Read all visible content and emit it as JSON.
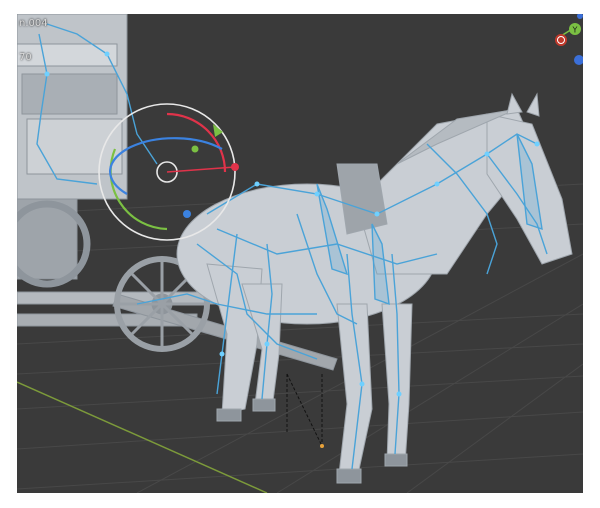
{
  "viewport": {
    "object_name": "n.004",
    "overlay_value": "70"
  },
  "axis_gizmo": {
    "y_axis_label": "Y"
  },
  "colors": {
    "background": "#3a3a3a",
    "grid": "#484848",
    "floor_x_axis": "#7c9a3a",
    "model": "#c9ced4",
    "armature": "#4aa3d8",
    "gizmo_x": "#e0334a",
    "gizmo_y": "#7bc043",
    "gizmo_z": "#3b82e0",
    "selection_ring": "#e8e8e8"
  }
}
